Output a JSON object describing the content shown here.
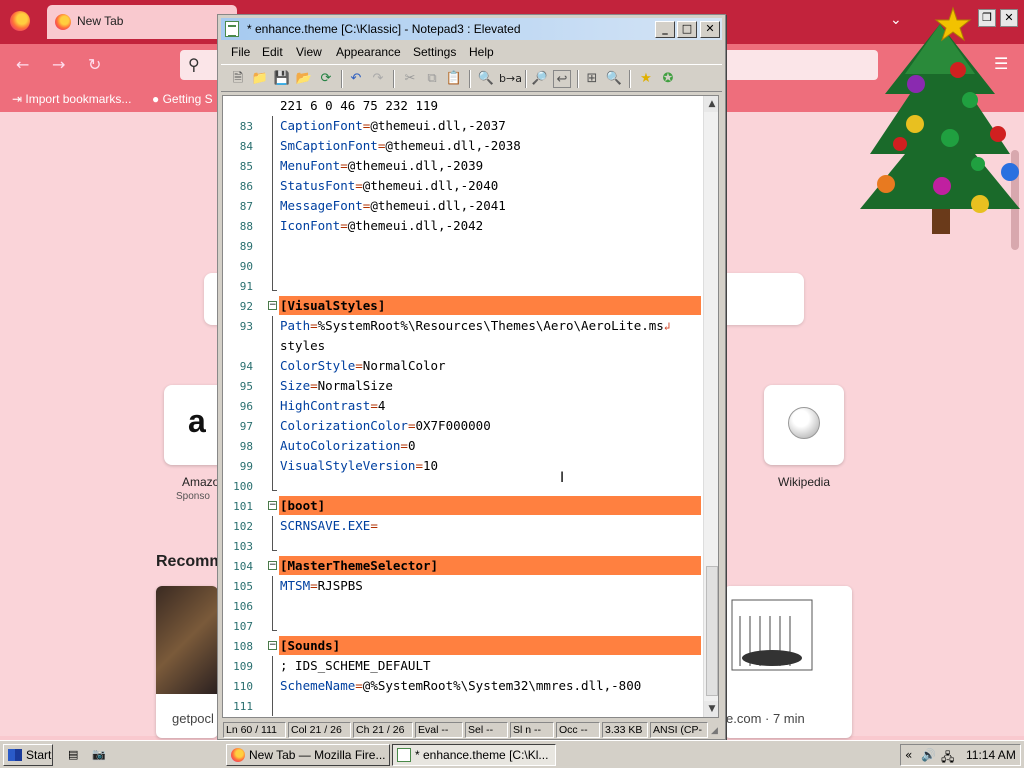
{
  "firefox": {
    "tab_label": "New Tab",
    "bookmarks": [
      "Import bookmarks...",
      "Getting S"
    ],
    "shortcuts": [
      {
        "label": "Amazo",
        "sublabel": "Sponso"
      },
      {
        "label": "Wikipedia",
        "sublabel": ""
      }
    ],
    "recommended_label": "Recomm",
    "cards": [
      {
        "source": "getpocl"
      },
      {
        "source": "e.com · 7 min"
      }
    ]
  },
  "notepad": {
    "title": "* enhance.theme [C:\\Klassic] - Notepad3 : Elevated",
    "menu": [
      "File",
      "Edit",
      "View",
      "Appearance",
      "Settings",
      "Help"
    ],
    "lines": [
      {
        "num": "",
        "type": "plain",
        "text": "221 6 0 46 75 232 119"
      },
      {
        "num": "83",
        "type": "kv",
        "key": "CaptionFont",
        "value": "@themeui.dll,-2037"
      },
      {
        "num": "84",
        "type": "kv",
        "key": "SmCaptionFont",
        "value": "@themeui.dll,-2038"
      },
      {
        "num": "85",
        "type": "kv",
        "key": "MenuFont",
        "value": "@themeui.dll,-2039"
      },
      {
        "num": "86",
        "type": "kv",
        "key": "StatusFont",
        "value": "@themeui.dll,-2040"
      },
      {
        "num": "87",
        "type": "kv",
        "key": "MessageFont",
        "value": "@themeui.dll,-2041"
      },
      {
        "num": "88",
        "type": "kv",
        "key": "IconFont",
        "value": "@themeui.dll,-2042"
      },
      {
        "num": "89",
        "type": "empty"
      },
      {
        "num": "90",
        "type": "empty"
      },
      {
        "num": "91",
        "type": "empty-end"
      },
      {
        "num": "92",
        "type": "section",
        "text": "[VisualStyles]"
      },
      {
        "num": "93",
        "type": "kv",
        "key": "Path",
        "value": "%SystemRoot%\\Resources\\Themes\\Aero\\AeroLite.ms",
        "wrap": true
      },
      {
        "num": "",
        "type": "plain",
        "text": "styles"
      },
      {
        "num": "94",
        "type": "kv",
        "key": "ColorStyle",
        "value": "NormalColor"
      },
      {
        "num": "95",
        "type": "kv",
        "key": "Size",
        "value": "NormalSize"
      },
      {
        "num": "96",
        "type": "kv",
        "key": "HighContrast",
        "value": "4"
      },
      {
        "num": "97",
        "type": "kv",
        "key": "ColorizationColor",
        "value": "0X7F000000"
      },
      {
        "num": "98",
        "type": "kv",
        "key": "AutoColorization",
        "value": "0"
      },
      {
        "num": "99",
        "type": "kv",
        "key": "VisualStyleVersion",
        "value": "10"
      },
      {
        "num": "100",
        "type": "empty-end"
      },
      {
        "num": "101",
        "type": "section",
        "text": "[boot]"
      },
      {
        "num": "102",
        "type": "kv",
        "key": "SCRNSAVE.EXE",
        "value": ""
      },
      {
        "num": "103",
        "type": "empty-end"
      },
      {
        "num": "104",
        "type": "section",
        "text": "[MasterThemeSelector]"
      },
      {
        "num": "105",
        "type": "kv",
        "key": "MTSM",
        "value": "RJSPBS"
      },
      {
        "num": "106",
        "type": "empty"
      },
      {
        "num": "107",
        "type": "empty-end"
      },
      {
        "num": "108",
        "type": "section",
        "text": "[Sounds]"
      },
      {
        "num": "109",
        "type": "comment",
        "text": "; IDS_SCHEME_DEFAULT"
      },
      {
        "num": "110",
        "type": "kv",
        "key": "SchemeName",
        "value": "@%SystemRoot%\\System32\\mmres.dll,-800"
      },
      {
        "num": "111",
        "type": "empty"
      }
    ],
    "status": [
      "Ln 60 / 111",
      "Col 21 / 26",
      "Ch 21 / 26",
      "Eval --",
      "Sel --",
      "Sl n --",
      "Occ --",
      "3.33 KB",
      "ANSI (CP-"
    ]
  },
  "taskbar": {
    "start_label": "Start",
    "tasks": [
      {
        "label": "New Tab — Mozilla Fire...",
        "active": false
      },
      {
        "label": "* enhance.theme [C:\\Kl...",
        "active": true
      }
    ],
    "clock": "11:14 AM"
  },
  "colors": {
    "firefox_tabbar": "#c2233c",
    "firefox_toolbar": "#ee6e7c",
    "section_highlight": "#ff8040",
    "line_number": "#2a6f6f"
  }
}
